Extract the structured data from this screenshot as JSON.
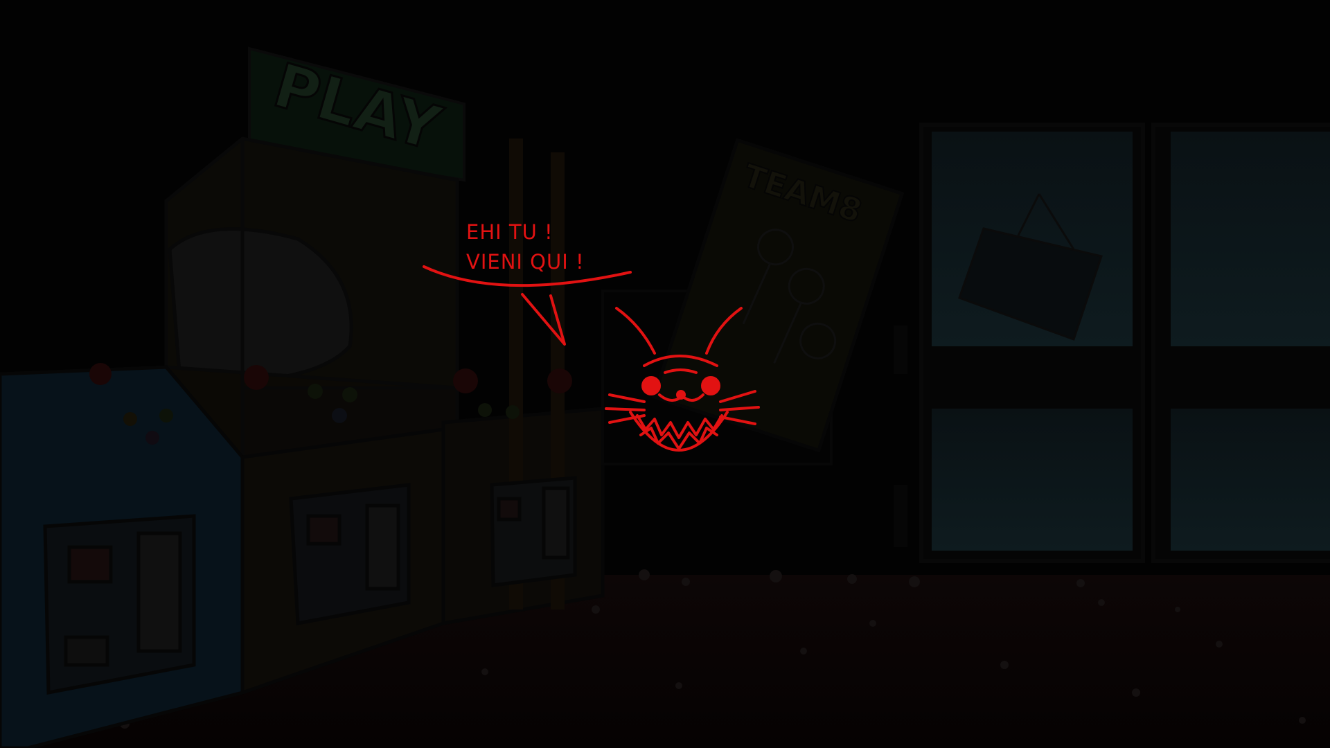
{
  "scene": {
    "setting": "arcade",
    "lighting": "dark",
    "accent_color": "#e21212"
  },
  "dialogue": {
    "line1": "EHI TU !",
    "line2": "VIENI QUI !"
  },
  "signs": {
    "play_sign": "PLAY",
    "poster_title": "TEAM8"
  },
  "character": {
    "icon": "grinning-rabbit-face-icon",
    "color": "#e21212"
  }
}
